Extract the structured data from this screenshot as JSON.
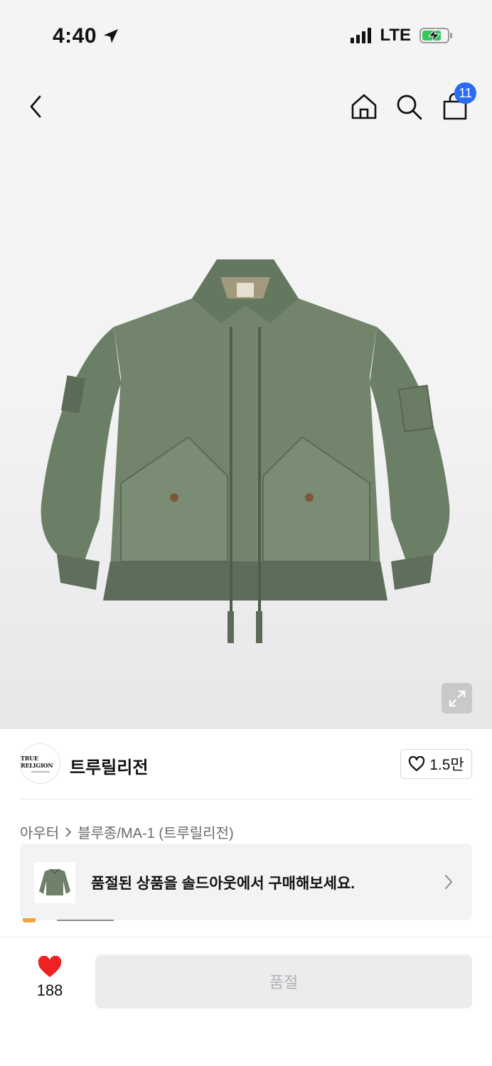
{
  "status_bar": {
    "time": "4:40",
    "network": "LTE"
  },
  "header": {
    "cart_count": "11"
  },
  "brand": {
    "logo_text": "TRUE RELIGION",
    "name": "트루릴리전",
    "like_count": "1.5만"
  },
  "breadcrumb": {
    "level1": "아우터",
    "level2": "블루종/MA-1 (트루릴리전)"
  },
  "banner": {
    "text": "품절된 상품을 솔드아웃에서 구매해보세요."
  },
  "bottom": {
    "wish_count": "188",
    "soldout_label": "품절"
  },
  "colors": {
    "badge": "#2b6bf3",
    "heart": "#ee2222",
    "jacket": "#6f816a"
  }
}
